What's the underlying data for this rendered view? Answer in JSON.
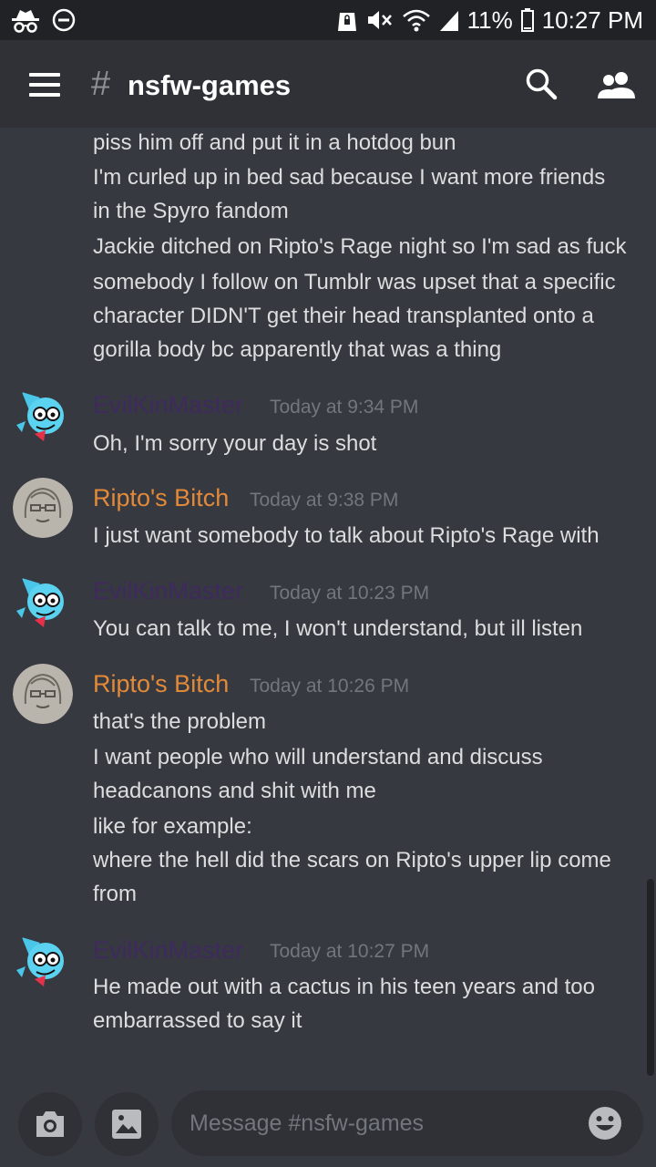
{
  "status_bar": {
    "battery": "11%",
    "time": "10:27 PM",
    "left_icons": [
      "incognito-icon",
      "do-not-disturb-icon"
    ],
    "right_icons": [
      "alarm-lock-icon",
      "mute-icon",
      "wifi-icon",
      "signal-icon",
      "battery-icon"
    ]
  },
  "header": {
    "hash": "#",
    "channel": "nsfw-games",
    "icons": [
      "menu-icon",
      "search-icon",
      "members-icon"
    ]
  },
  "colors": {
    "background": "#36393f",
    "header_bg": "#2f3136",
    "status_bg": "#202225",
    "text": "#dcddde",
    "timestamp": "#72767d",
    "evilkinmaster": "#3f2a5e",
    "ripto": "#e28a3a"
  },
  "messages": {
    "continued": [
      "piss him off and put it in a hotdog bun",
      "I'm curled up in bed sad because I want more friends",
      "in the Spyro fandom",
      "Jackie ditched on Ripto's Rage night so I'm sad as fuck",
      "somebody I follow on Tumblr was upset that a specific",
      "character DIDN'T get their head transplanted onto a",
      "gorilla body bc apparently that was a thing"
    ],
    "groups": [
      {
        "author": "EvilKinMaster",
        "time": "Today at 9:34 PM",
        "lines": [
          "Oh, I'm sorry your day is shot"
        ]
      },
      {
        "author": "Ripto's Bitch",
        "time": "Today at 9:38 PM",
        "lines": [
          "I just want somebody to talk about Ripto's Rage with"
        ]
      },
      {
        "author": "EvilKinMaster",
        "time": "Today at 10:23 PM",
        "lines": [
          "You can talk to me, I won't understand, but ill listen"
        ]
      },
      {
        "author": "Ripto's Bitch",
        "time": "Today at 10:26 PM",
        "lines": [
          "that's the problem",
          "I want people who will understand and discuss",
          "headcanons and shit with me",
          "like for example:",
          "where the hell did the scars on Ripto's upper lip come",
          "from"
        ]
      },
      {
        "author": "EvilKinMaster",
        "time": "Today at 10:27 PM",
        "lines": [
          "He made out with a cactus in his teen years and too",
          "embarrassed to say it"
        ]
      }
    ]
  },
  "input": {
    "placeholder": "Message #nsfw-games",
    "icons": [
      "camera-icon",
      "image-icon",
      "emoji-icon"
    ]
  }
}
